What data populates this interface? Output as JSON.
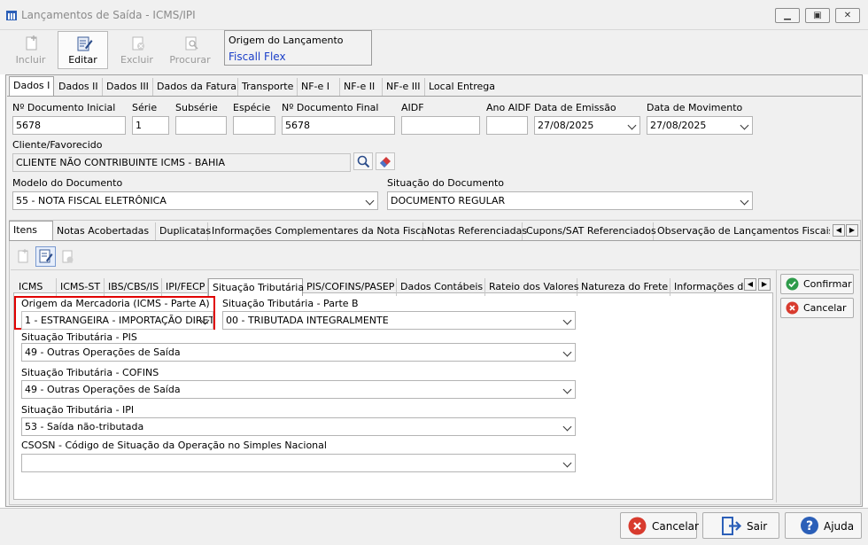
{
  "window": {
    "title": "Lançamentos de Saída - ICMS/IPI",
    "controls": [
      "▁",
      "▣",
      "✕"
    ]
  },
  "toolbar": {
    "incluir": "Incluir",
    "editar": "Editar",
    "excluir": "Excluir",
    "procurar": "Procurar",
    "origem_title": "Origem do Lançamento",
    "origem_value": "Fiscall Flex"
  },
  "main_tabs": [
    "Dados I",
    "Dados II",
    "Dados III",
    "Dados da Fatura",
    "Transporte",
    "NF-e I",
    "NF-e II",
    "NF-e III",
    "Local Entrega"
  ],
  "dados": {
    "num_doc_inicial": {
      "label": "Nº Documento Inicial",
      "value": "5678"
    },
    "serie": {
      "label": "Série",
      "value": "1"
    },
    "subserie": {
      "label": "Subsérie",
      "value": ""
    },
    "especie": {
      "label": "Espécie",
      "value": ""
    },
    "num_doc_final": {
      "label": "Nº Documento Final",
      "value": "5678"
    },
    "aidf": {
      "label": "AIDF",
      "value": ""
    },
    "ano_aidf": {
      "label": "Ano AIDF",
      "value": ""
    },
    "data_emissao": {
      "label": "Data de Emissão",
      "value": "27/08/2025"
    },
    "data_movimento": {
      "label": "Data de Movimento",
      "value": "27/08/2025"
    },
    "cliente": {
      "label": "Cliente/Favorecido",
      "value": "CLIENTE NÃO CONTRIBUINTE ICMS - BAHIA"
    },
    "modelo": {
      "label": "Modelo do Documento",
      "value": "55 - NOTA FISCAL ELETRÔNICA"
    },
    "situacao": {
      "label": "Situação do Documento",
      "value": "DOCUMENTO REGULAR"
    }
  },
  "item_tabs": [
    "Itens",
    "Notas Acobertadas",
    "Duplicatas",
    "Informações Complementares da Nota Fiscal",
    "Notas Referenciadas",
    "Cupons/SAT Referenciados",
    "Observação de Lançamentos Fiscais (C"
  ],
  "tax_tabs": [
    "ICMS",
    "ICMS-ST",
    "IBS/CBS/IS",
    "IPI/FECP",
    "Situação Tributária",
    "PIS/COFINS/PASEP",
    "Dados Contábeis",
    "Rateio dos Valores",
    "Natureza do Frete",
    "Informações de"
  ],
  "situacao_tributaria": {
    "origem": {
      "label": "Origem da Mercadoria (ICMS - Parte A)",
      "value": "1 - ESTRANGEIRA - IMPORTAÇÃO DIRET"
    },
    "parte_b": {
      "label": "Situação Tributária - Parte B",
      "value": "00 - TRIBUTADA INTEGRALMENTE"
    },
    "pis": {
      "label": "Situação Tributária - PIS",
      "value": "49 - Outras Operações de Saída"
    },
    "cofins": {
      "label": "Situação Tributária - COFINS",
      "value": "49 - Outras Operações de Saída"
    },
    "ipi": {
      "label": "Situação Tributária - IPI",
      "value": "53 - Saída não-tributada"
    },
    "csosn": {
      "label": "CSOSN - Código de Situação da Operação no Simples Nacional",
      "value": ""
    }
  },
  "side_buttons": {
    "confirmar": "Confirmar",
    "cancelar": "Cancelar"
  },
  "bottom_buttons": {
    "cancelar": "Cancelar",
    "sair": "Sair",
    "ajuda": "Ajuda"
  }
}
